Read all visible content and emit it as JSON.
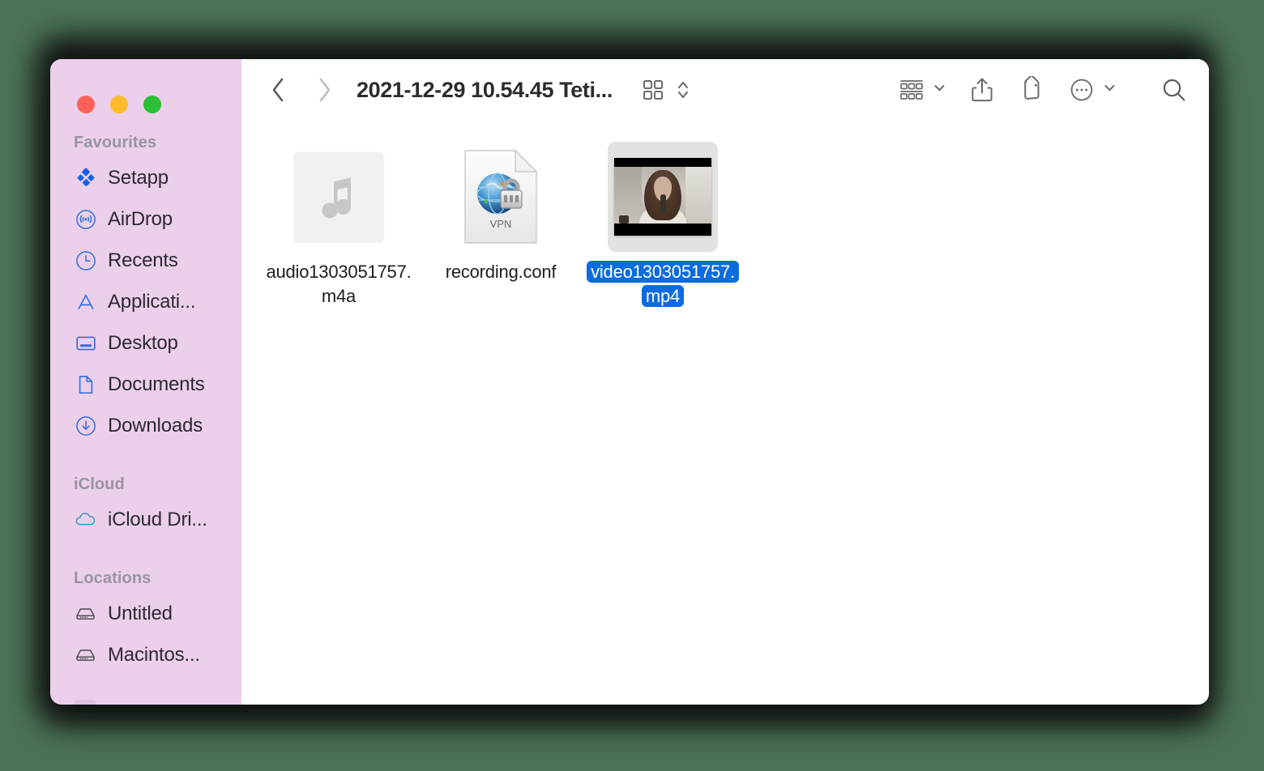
{
  "desktop": {
    "background_color": "#4a7255"
  },
  "window": {
    "title": "2021-12-29 10.54.45 Teti...",
    "traffic_lights": [
      {
        "name": "close",
        "color": "#f9635a"
      },
      {
        "name": "minimize",
        "color": "#fbbd2e"
      },
      {
        "name": "maximize",
        "color": "#2ac034"
      }
    ]
  },
  "toolbar": {
    "back_label": "Back",
    "forward_label": "Forward",
    "view_icon": "grid-view-icon",
    "view_stepper_icon": "chevron-up-down-icon",
    "group_icon": "group-items-icon",
    "group_chevron_icon": "chevron-down-icon",
    "share_icon": "share-icon",
    "tag_icon": "tag-icon",
    "more_icon": "ellipsis-circle-icon",
    "more_chevron_icon": "chevron-down-icon",
    "search_icon": "search-icon"
  },
  "sidebar": {
    "background_color": "#eccfeb",
    "sections": [
      {
        "title": "Favourites",
        "items": [
          {
            "label": "Setapp",
            "icon": "setapp-icon"
          },
          {
            "label": "AirDrop",
            "icon": "airdrop-icon"
          },
          {
            "label": "Recents",
            "icon": "clock-icon"
          },
          {
            "label": "Applicati...",
            "icon": "applications-icon"
          },
          {
            "label": "Desktop",
            "icon": "desktop-icon"
          },
          {
            "label": "Documents",
            "icon": "document-icon"
          },
          {
            "label": "Downloads",
            "icon": "downloads-icon"
          }
        ]
      },
      {
        "title": "iCloud",
        "items": [
          {
            "label": "iCloud Dri...",
            "icon": "cloud-icon"
          }
        ]
      },
      {
        "title": "Locations",
        "items": [
          {
            "label": "Untitled",
            "icon": "hard-drive-icon"
          },
          {
            "label": "Macintos...",
            "icon": "hard-drive-icon"
          }
        ]
      }
    ]
  },
  "files": [
    {
      "name_line1": "audio1303051757.",
      "name_line2": "m4a",
      "icon": "music-note-icon",
      "kind": "audio",
      "selected": false
    },
    {
      "name_line1": "recording.conf",
      "name_line2": "",
      "icon": "vpn-document-icon",
      "icon_badge_label": "VPN",
      "kind": "conf",
      "selected": false
    },
    {
      "name_line1": "video1303051757.",
      "name_line2": "mp4",
      "icon": "video-thumbnail-icon",
      "kind": "video",
      "selected": true
    }
  ],
  "selection": {
    "highlight_color": "#0b6be0",
    "icon_background_color": "#e2e2e2"
  }
}
